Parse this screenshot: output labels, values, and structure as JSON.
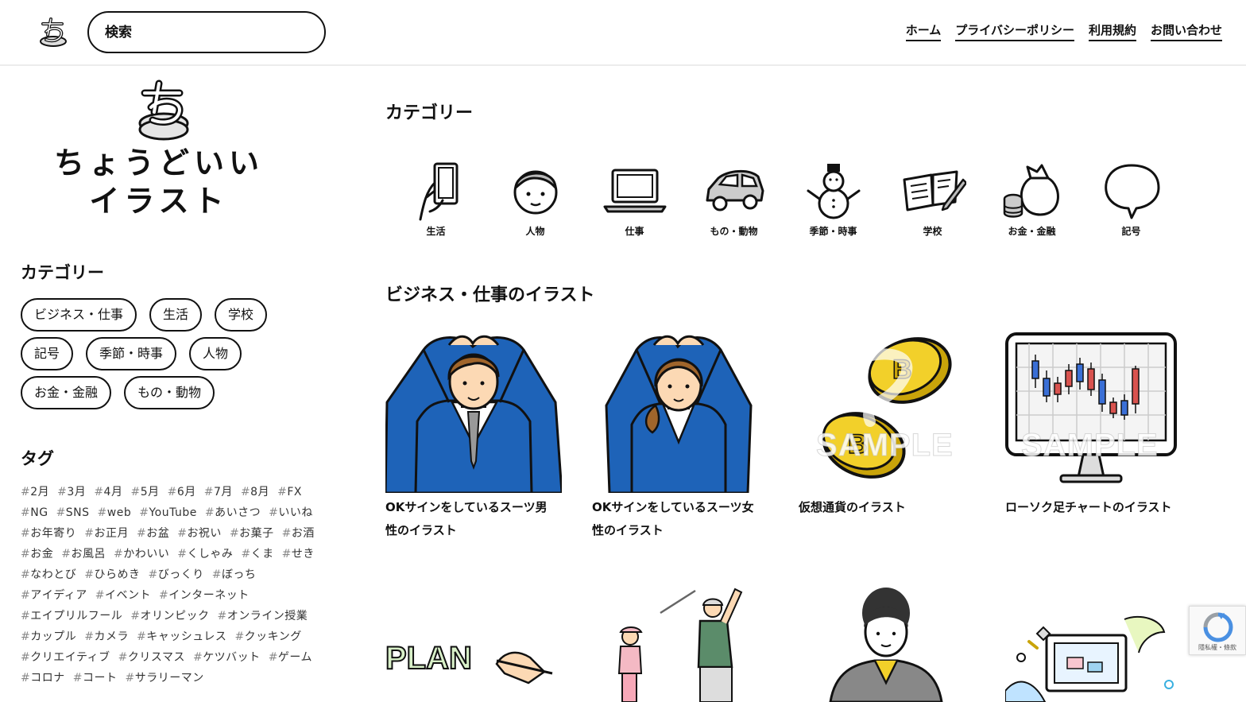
{
  "header": {
    "search_placeholder": "検索",
    "nav": [
      "ホーム",
      "プライバシーポリシー",
      "利用規約",
      "お問い合わせ"
    ]
  },
  "sidebar": {
    "brand_line1": "ちょうどいい",
    "brand_line2": "イラスト",
    "category_heading": "カテゴリー",
    "categories": [
      "ビジネス・仕事",
      "生活",
      "学校",
      "記号",
      "季節・時事",
      "人物",
      "お金・金融",
      "もの・動物"
    ],
    "tag_heading": "タグ",
    "tags": [
      "2月",
      "3月",
      "4月",
      "5月",
      "6月",
      "7月",
      "8月",
      "FX",
      "NG",
      "SNS",
      "web",
      "YouTube",
      "あいさつ",
      "いいね",
      "お年寄り",
      "お正月",
      "お盆",
      "お祝い",
      "お菓子",
      "お酒",
      "お金",
      "お風呂",
      "かわいい",
      "くしゃみ",
      "くま",
      "せき",
      "なわとび",
      "ひらめき",
      "びっくり",
      "ぼっち",
      "アイディア",
      "イベント",
      "インターネット",
      "エイプリルフール",
      "オリンピック",
      "オンライン授業",
      "カップル",
      "カメラ",
      "キャッシュレス",
      "クッキング",
      "クリエイティブ",
      "クリスマス",
      "ケツバット",
      "ゲーム",
      "コロナ",
      "コート",
      "サラリーマン"
    ]
  },
  "main": {
    "category_heading": "カテゴリー",
    "category_icons": [
      {
        "label": "生活",
        "icon": "smartphone-hand-icon"
      },
      {
        "label": "人物",
        "icon": "person-face-icon"
      },
      {
        "label": "仕事",
        "icon": "laptop-icon"
      },
      {
        "label": "もの・動物",
        "icon": "car-icon"
      },
      {
        "label": "季節・時事",
        "icon": "snowman-icon"
      },
      {
        "label": "学校",
        "icon": "notebook-pencil-icon"
      },
      {
        "label": "お金・金融",
        "icon": "money-bag-icon"
      },
      {
        "label": "記号",
        "icon": "speech-bubble-icon"
      }
    ],
    "section_heading": "ビジネス・仕事のイラスト",
    "cards": [
      {
        "caption": "OKサインをしているスーツ男性のイラスト"
      },
      {
        "caption": "OKサインをしているスーツ女性のイラスト"
      },
      {
        "caption": "仮想通貨のイラスト",
        "watermark": "SAMPLE"
      },
      {
        "caption": "ローソク足チャートのイラスト",
        "watermark": "SAMPLE"
      }
    ],
    "second_row_text": {
      "plan": "PLAN"
    }
  },
  "recaptcha": {
    "text": "隱私權・條款"
  }
}
